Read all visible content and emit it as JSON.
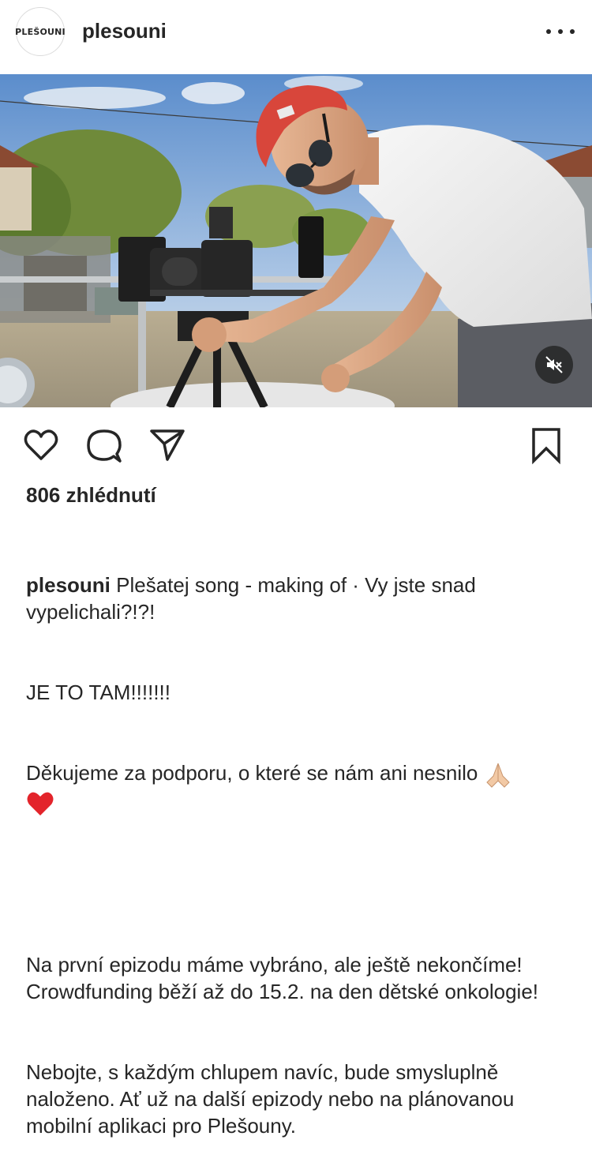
{
  "post": {
    "username": "plesouni",
    "avatar_text": "PLEŠOUNI",
    "views_text": "806 zhlédnutí",
    "caption": {
      "username": "plesouni",
      "line1": "Plešatej song - making of · Vy jste snad vypelichali?!?!",
      "line2": "JE TO TAM!!!!!!!",
      "line3": "Děkujeme za podporu, o které se nám ani nesnilo",
      "line4": "Na první epizodu máme vybráno, ale ještě nekončíme! Crowdfunding běží až do 15.2. na den dětské onkologie!",
      "line5": "Nebojte, s každým chlupem navíc, bude smysluplně naloženo. Ať už na další epizody nebo na plánovanou mobilní aplikaci pro Plešouny."
    }
  },
  "icons": {
    "more": "more-options-icon",
    "mute": "muted-speaker-icon",
    "like": "heart-icon",
    "comment": "comment-bubble-icon",
    "share": "paper-plane-icon",
    "save": "bookmark-icon",
    "pray": "folded-hands-emoji",
    "heart_emoji": "red-heart-emoji"
  },
  "colors": {
    "text": "#262626",
    "sky": "#7fa8d6",
    "beanie": "#d8463b"
  }
}
